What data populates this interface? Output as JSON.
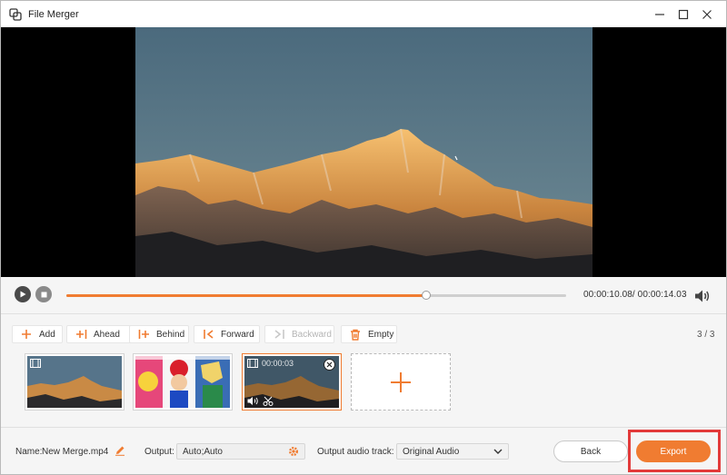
{
  "window": {
    "title": "File Merger",
    "controls": [
      "minimize-icon",
      "maximize-icon",
      "close-icon"
    ]
  },
  "player": {
    "current_time": "00:00:10.08",
    "total_time": "00:00:14.03",
    "time_display": "00:00:10.08/ 00:00:14.03",
    "progress_fraction": 0.72
  },
  "toolbar": {
    "add": "Add",
    "ahead": "Ahead",
    "behind": "Behind",
    "forward": "Forward",
    "backward": "Backward",
    "empty": "Empty",
    "counter": "3 / 3"
  },
  "clips": [
    {
      "kind": "mountain",
      "duration": "",
      "selected": false
    },
    {
      "kind": "game-art",
      "duration": "",
      "selected": false
    },
    {
      "kind": "mountain",
      "duration": "00:00:03",
      "selected": true
    }
  ],
  "footer": {
    "name_label": "Name:",
    "name_value": "New Merge.mp4",
    "output_label": "Output:",
    "output_value": "Auto;Auto",
    "audio_label": "Output audio track:",
    "audio_value": "Original Audio",
    "back": "Back",
    "export": "Export"
  },
  "colors": {
    "accent": "#f07c31",
    "highlight": "#e23a3a"
  }
}
